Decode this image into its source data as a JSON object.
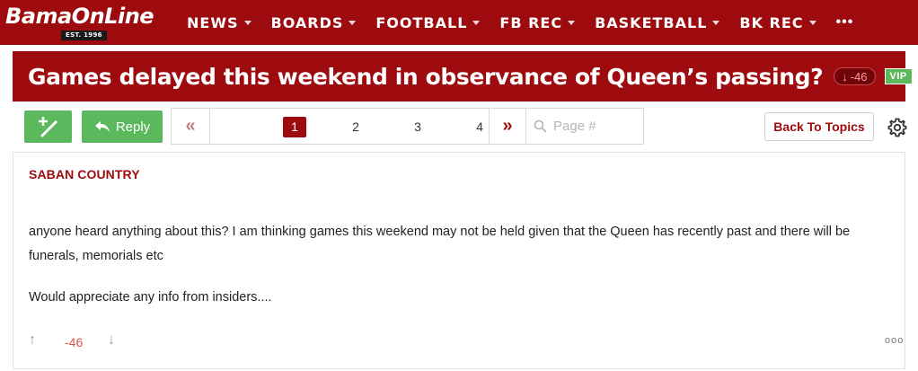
{
  "site": {
    "logo_text": "BamaOnLine",
    "logo_est": "EST. 1996"
  },
  "nav": {
    "items": [
      {
        "label": "NEWS"
      },
      {
        "label": "BOARDS"
      },
      {
        "label": "FOOTBALL"
      },
      {
        "label": "FB REC"
      },
      {
        "label": "BASKETBALL"
      },
      {
        "label": "BK REC"
      }
    ],
    "more_label": "•••"
  },
  "thread": {
    "title": "Games delayed this weekend in observance of Queen’s passing?",
    "score": "-46",
    "score_arrow": "↓",
    "badge": "VIP"
  },
  "toolbar": {
    "reply_label": "Reply",
    "first_page_glyph": "«",
    "next_page_glyph": "»",
    "pages": [
      "1",
      "2",
      "3",
      "4"
    ],
    "current_page": "1",
    "page_input_placeholder": "Page #",
    "back_label": "Back To Topics"
  },
  "post": {
    "author": "SABAN COUNTRY",
    "paragraphs": [
      "anyone heard anything about this? I am thinking games this weekend may not be held given that the Queen has recently past and there will be funerals, memorials etc",
      "Would appreciate any info from insiders...."
    ],
    "score": "-46",
    "upvote_glyph": "↑",
    "downvote_glyph": "↓",
    "more_glyph": "ooo"
  },
  "colors": {
    "brand": "#9e0b0f",
    "green": "#5cb85c",
    "negative": "#d9534f"
  }
}
